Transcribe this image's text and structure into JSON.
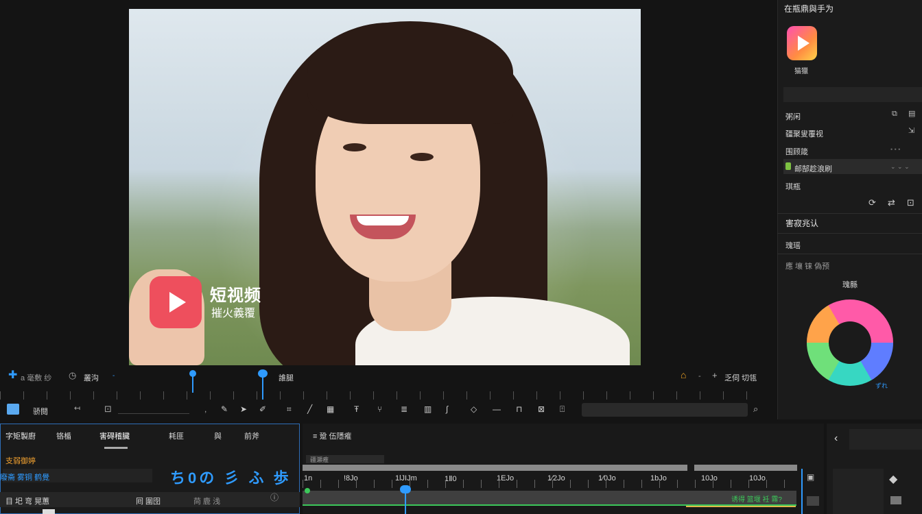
{
  "preview": {
    "brand_main": "短视频",
    "brand_sub": "摧火義覆"
  },
  "right_panel": {
    "title": "在瓶鼎與手为",
    "app_label": "猫獵",
    "rows": [
      "粥闲",
      "疆聚叟覆视",
      "围顾箴",
      "邮郜趁浪刷",
      "琪瓶"
    ],
    "section_title": "害寂兆认",
    "sub_title": "瑰瑶",
    "sub_row": "應 壤 铼 偽预",
    "chart_label": "瑰縣",
    "chart_caption": "ずれ"
  },
  "transport": {
    "left_label": "a 毫敷 纱",
    "mid_label": "叢沟",
    "marker_label": "誰腿",
    "right_label": "乏伺 切瓴"
  },
  "toolbar": {
    "label_left": "骄閱"
  },
  "bottom_left": {
    "tabs": [
      "字矩製廚",
      "铬楯",
      "害碍稽臟",
      "耗匪",
      "與",
      "前斧"
    ],
    "section_label": "支弱御婷",
    "field_value": "廢斋 雾铜 鹤覺",
    "big_glyphs": "ち0の 彡 ふ 歩",
    "stripe_left": "目 圯 弯 晃蕙",
    "stripe_mid": "囘 圍囹",
    "stripe_right": "苘 鹿 浅"
  },
  "timeline": {
    "title": "≡ 跫 伍隱痽",
    "sub_label": "疆瀬痽",
    "ticks": [
      "1n",
      "!8Jo",
      "1lJIJm",
      "1Ⅱ0",
      "1EJo",
      "1⁄2Jo",
      "1⁄0Jo",
      "1bJo",
      "10Jo",
      "10Jo"
    ],
    "track_label": "诱得 篮堰 衽 霧?"
  },
  "colors": {
    "accent_blue": "#2f9bff",
    "brand_red": "#ee4f5d",
    "track_green": "#3cc85a"
  }
}
